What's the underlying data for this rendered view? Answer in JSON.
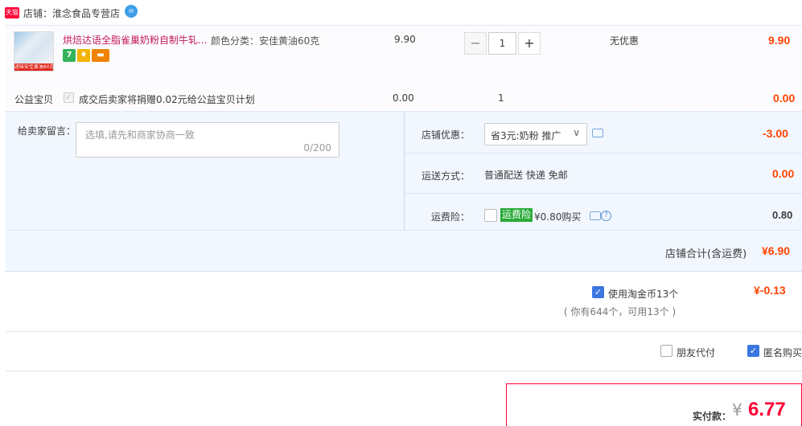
{
  "shop": {
    "badge": "天猫",
    "label": "店铺：淮念食品专营店",
    "ww_icon": "wangwang-icon"
  },
  "item": {
    "thumb_caption": "进味安佳黄油60克",
    "title": "烘焙达语全脂雀巢奶粉自制牛轧...",
    "spec": "颜色分类：安佳黄油60克",
    "price": "9.90",
    "qty_minus": "−",
    "qty": "1",
    "qty_plus": "+",
    "promo": "无优惠",
    "total": "9.90",
    "service_icons": [
      "seven-day-return-icon",
      "guarantee-icon",
      "credit-card-icon"
    ]
  },
  "charity": {
    "label": "公益宝贝",
    "check": "✓",
    "text": "成交后卖家将捐赠0.02元给公益宝贝计划",
    "amount": "0.00",
    "qty": "1",
    "total": "0.00"
  },
  "memo": {
    "label": "给卖家留言：",
    "placeholder": "选填,请先和商家协商一致",
    "count": "0/200"
  },
  "coupon": {
    "label": "店铺优惠：",
    "selected": "省3元:奶粉 推广",
    "arrow": "∨",
    "value": "-3.00"
  },
  "shipping": {
    "label": "运送方式：",
    "method": "普通配送 快递 免邮",
    "value": "0.00"
  },
  "insurance": {
    "label": "运费险：",
    "badge": "运费险",
    "price": "¥0.80购买",
    "help": "?",
    "value": "0.80"
  },
  "shop_total": {
    "label": "店铺合计(含运费)",
    "value": "¥6.90"
  },
  "coins": {
    "check": "✓",
    "label": "使用淘金币13个",
    "sub": "( 你有644个，可用13个 )",
    "value": "¥-0.13"
  },
  "options": {
    "friend_pay": "朋友代付",
    "anon_check": "✓",
    "anonymous": "匿名购买"
  },
  "payment": {
    "label": "实付款：",
    "currency": "¥",
    "value": "6.77"
  },
  "colors": {
    "accent_red": "#ff0036",
    "price_red": "#ff4400",
    "checkbox_blue": "#3b76e1",
    "badge_green": "#2bab3a"
  }
}
